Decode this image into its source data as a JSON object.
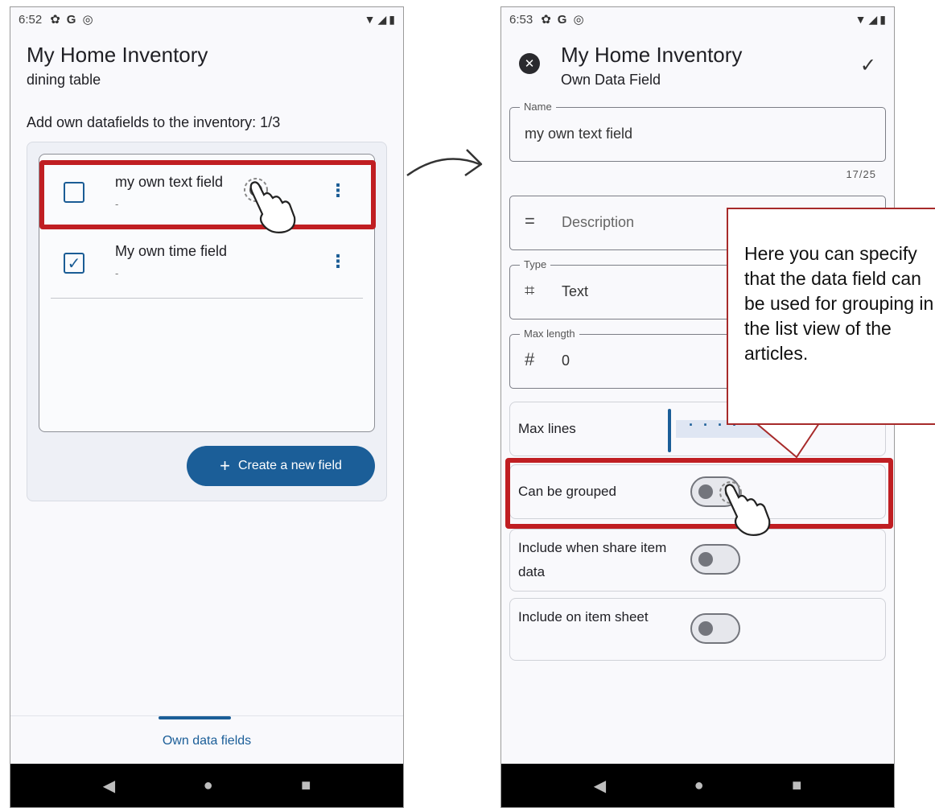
{
  "left": {
    "status": {
      "time": "6:52"
    },
    "app_title": "My Home Inventory",
    "subtitle": "dining table",
    "section_header": "Add own datafields to the inventory: 1/3",
    "items": [
      {
        "title": "my own text field",
        "sub": "-",
        "checked": false
      },
      {
        "title": "My own time field",
        "sub": "-",
        "checked": true
      }
    ],
    "fab_label": "Create a new field",
    "bottom_tab_label": "Own data fields"
  },
  "right": {
    "status": {
      "time": "6:53"
    },
    "app_title": "My Home Inventory",
    "subtitle": "Own Data Field",
    "name_field": {
      "label": "Name",
      "value": "my own text field",
      "counter": "17/25"
    },
    "description_placeholder": "Description",
    "type_field": {
      "label": "Type",
      "value": "Text"
    },
    "max_length_field": {
      "label": "Max length",
      "value": "0"
    },
    "max_lines_label": "Max lines",
    "can_be_grouped_label": "Can be grouped",
    "include_share_label": "Include when share item data",
    "include_sheet_label": "Include on item sheet",
    "toggles": {
      "can_be_grouped": false,
      "include_share": false,
      "include_sheet": false
    }
  },
  "callout_text": "Here you can specify that the data field can be used for grouping in the list view of the articles.",
  "colors": {
    "accent": "#1b5e98",
    "highlight": "#c01e22",
    "callout_border": "#a72a2a"
  }
}
